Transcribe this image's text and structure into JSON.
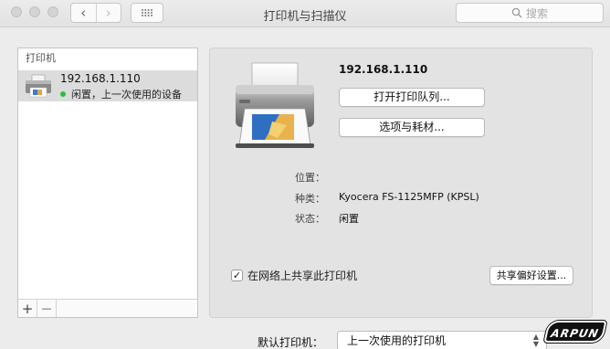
{
  "window": {
    "title": "打印机与扫描仪"
  },
  "toolbar": {
    "back_label": "‹",
    "forward_label": "›",
    "search_placeholder": "搜索"
  },
  "printer_list": {
    "header": "打印机",
    "items": [
      {
        "name": "192.168.1.110",
        "status": "闲置，上一次使用的设备",
        "status_color": "#2bbf3a"
      }
    ],
    "add_label": "+",
    "remove_label": "—"
  },
  "detail": {
    "printer_name": "192.168.1.110",
    "open_queue_label": "打开打印队列...",
    "options_label": "选项与耗材...",
    "location_label": "位置：",
    "location_value": "",
    "kind_label": "种类：",
    "kind_value": "Kyocera FS-1125MFP (KPSL)",
    "status_label": "状态：",
    "status_value": "闲置",
    "share_checked": true,
    "share_label": "在网络上共享此打印机",
    "share_prefs_label": "共享偏好设置..."
  },
  "footer": {
    "default_printer_label": "默认打印机：",
    "default_printer_value": "上一次使用的打印机"
  },
  "watermark": {
    "text": "ARPUN"
  }
}
